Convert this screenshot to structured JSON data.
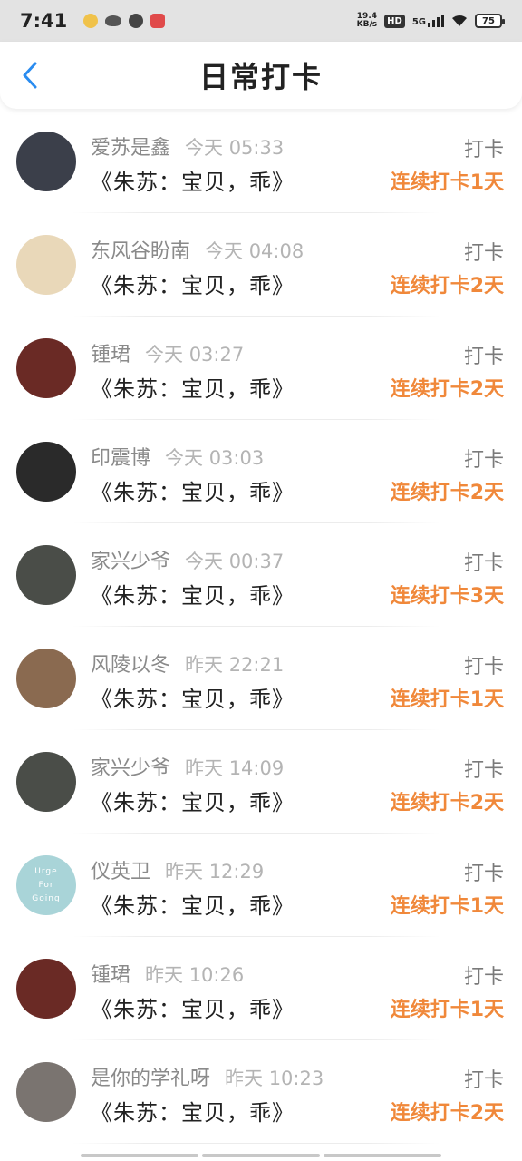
{
  "status_bar": {
    "time": "7:41",
    "network_speed_value": "19.4",
    "network_speed_unit": "KB/s",
    "hd_label": "HD",
    "network_type": "5G",
    "battery": "75"
  },
  "header": {
    "title": "日常打卡"
  },
  "colors": {
    "accent_orange": "#f0883a",
    "name_gray": "#8a8a8a",
    "time_gray": "#b4b4b4"
  },
  "entries": [
    {
      "name": "爱苏是鑫",
      "time": "今天 05:33",
      "title": "《朱苏：宝贝，乖》",
      "tag": "打卡",
      "streak": "连续打卡1天",
      "avatar_color": "#3b3f4a"
    },
    {
      "name": "东风谷盼南",
      "time": "今天 04:08",
      "title": "《朱苏：宝贝，乖》",
      "tag": "打卡",
      "streak": "连续打卡2天",
      "avatar_color": "#e9d8b9"
    },
    {
      "name": "锺珺",
      "time": "今天 03:27",
      "title": "《朱苏：宝贝，乖》",
      "tag": "打卡",
      "streak": "连续打卡2天",
      "avatar_color": "#6a2a25"
    },
    {
      "name": "印震博",
      "time": "今天 03:03",
      "title": "《朱苏：宝贝，乖》",
      "tag": "打卡",
      "streak": "连续打卡2天",
      "avatar_color": "#2a2a2a"
    },
    {
      "name": "家兴少爷",
      "time": "今天 00:37",
      "title": "《朱苏：宝贝，乖》",
      "tag": "打卡",
      "streak": "连续打卡3天",
      "avatar_color": "#4a4d48"
    },
    {
      "name": "风陵以冬",
      "time": "昨天 22:21",
      "title": "《朱苏：宝贝，乖》",
      "tag": "打卡",
      "streak": "连续打卡1天",
      "avatar_color": "#8a6a50"
    },
    {
      "name": "家兴少爷",
      "time": "昨天 14:09",
      "title": "《朱苏：宝贝，乖》",
      "tag": "打卡",
      "streak": "连续打卡2天",
      "avatar_color": "#4a4d48"
    },
    {
      "name": "仪英卫",
      "time": "昨天 12:29",
      "title": "《朱苏：宝贝，乖》",
      "tag": "打卡",
      "streak": "连续打卡1天",
      "avatar_color": "#a9d4d8",
      "avatar_text": [
        "Urge",
        "For",
        "Going"
      ]
    },
    {
      "name": "锺珺",
      "time": "昨天 10:26",
      "title": "《朱苏：宝贝，乖》",
      "tag": "打卡",
      "streak": "连续打卡1天",
      "avatar_color": "#6a2a25"
    },
    {
      "name": "是你的学礼呀",
      "time": "昨天 10:23",
      "title": "《朱苏：宝贝，乖》",
      "tag": "打卡",
      "streak": "连续打卡2天",
      "avatar_color": "#7a7470"
    }
  ]
}
